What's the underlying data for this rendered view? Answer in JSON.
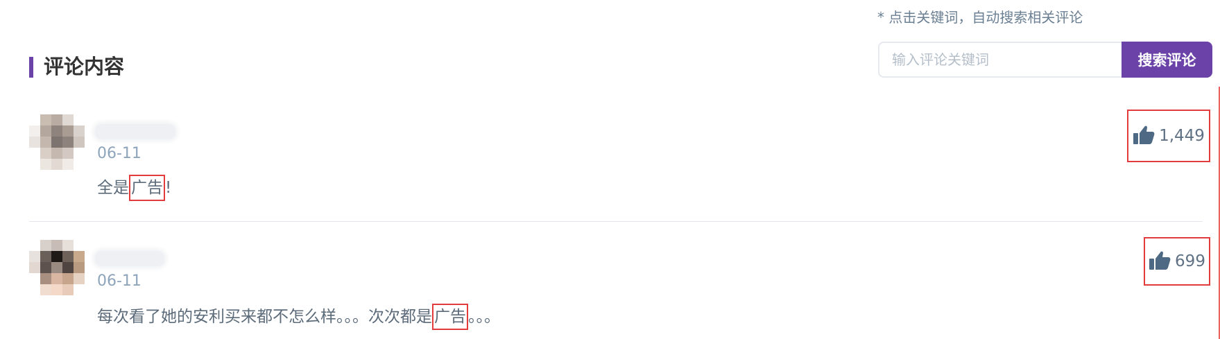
{
  "search": {
    "hint": "* 点击关键词，自动搜索相关评论",
    "placeholder": "输入评论关键词",
    "value": "",
    "button_label": "搜索评论"
  },
  "section": {
    "title": "评论内容"
  },
  "colors": {
    "accent": "#6a42a8",
    "highlight_border": "#e23b3b",
    "date": "#8ea4ba",
    "text": "#5c6b7a"
  },
  "comments": [
    {
      "avatar_icon": "user-avatar",
      "date": "06-11",
      "text_before": "全是",
      "keyword": "广告",
      "text_after": "!",
      "likes": "1,449",
      "like_icon": "thumbs-up-icon"
    },
    {
      "avatar_icon": "user-avatar",
      "date": "06-11",
      "text_before": "每次看了她的安利买来都不怎么样。。。次次都是",
      "keyword": "广告",
      "text_after": "。。。",
      "likes": "699",
      "like_icon": "thumbs-up-icon"
    }
  ]
}
